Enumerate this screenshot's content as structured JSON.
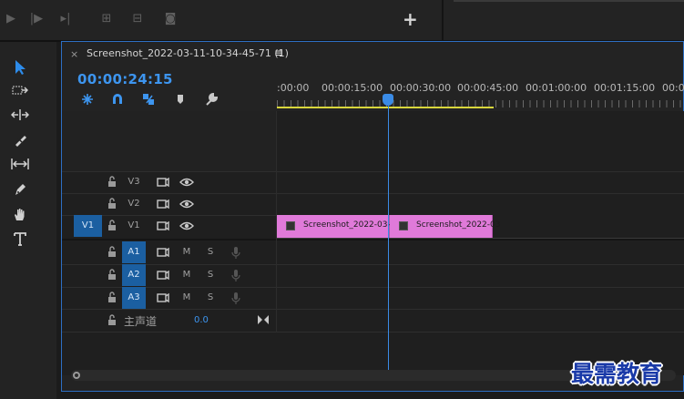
{
  "top_bar": {
    "add_button": "+"
  },
  "sequence": {
    "close": "×",
    "title": "Screenshot_2022-03-11-10-34-45-71 (1)",
    "menu": "≡",
    "timecode": "00:00:24:15"
  },
  "ruler": {
    "labels": [
      ":00:00",
      "00:00:15:00",
      "00:00:30:00",
      "00:00:45:00",
      "00:01:00:00",
      "00:01:15:00",
      "00:01"
    ]
  },
  "tracks": {
    "video": [
      {
        "name": "V3",
        "source": ""
      },
      {
        "name": "V2",
        "source": ""
      },
      {
        "name": "V1",
        "source": "V1"
      }
    ],
    "audio": [
      {
        "name": "A1",
        "m": "M",
        "s": "S"
      },
      {
        "name": "A2",
        "m": "M",
        "s": "S"
      },
      {
        "name": "A3",
        "m": "M",
        "s": "S"
      }
    ],
    "master": {
      "label": "主声道",
      "value": "0.0"
    }
  },
  "clips": [
    {
      "label": "Screenshot_2022-03-1",
      "color": "#e07ad9"
    },
    {
      "label": "Screenshot_2022-03",
      "color": "#e07ad9"
    }
  ],
  "colors": {
    "accent": "#3d95ef",
    "work_area": "#d8d63c",
    "clip": "#e07ad9"
  },
  "watermark": "最需教育"
}
